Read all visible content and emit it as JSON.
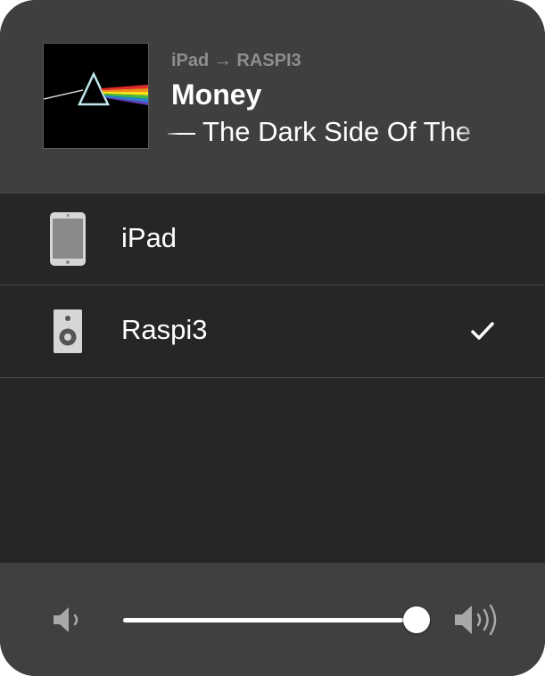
{
  "now_playing": {
    "artwork_icon": "album-artwork-prism",
    "route_source": "iPad",
    "route_arrow": "→",
    "route_target": "RASPI3",
    "song_title": "Money",
    "album_line": "— The Dark Side Of The"
  },
  "devices": [
    {
      "label": "iPad",
      "icon": "ipad-icon",
      "selected": false
    },
    {
      "label": "Raspi3",
      "icon": "speaker-icon",
      "selected": true
    }
  ],
  "selected_icon": "checkmark-icon",
  "volume": {
    "level": 0.95,
    "low_icon": "volume-low-icon",
    "high_icon": "volume-high-icon"
  },
  "colors": {
    "panel_background": "#262626",
    "header_background": "#3f3f3f",
    "footer_background": "#404040",
    "separator": "#4a4a4a",
    "text_primary": "#ffffff",
    "text_secondary": "#8e8e8e",
    "icon_gray": "#a8a8a8"
  }
}
